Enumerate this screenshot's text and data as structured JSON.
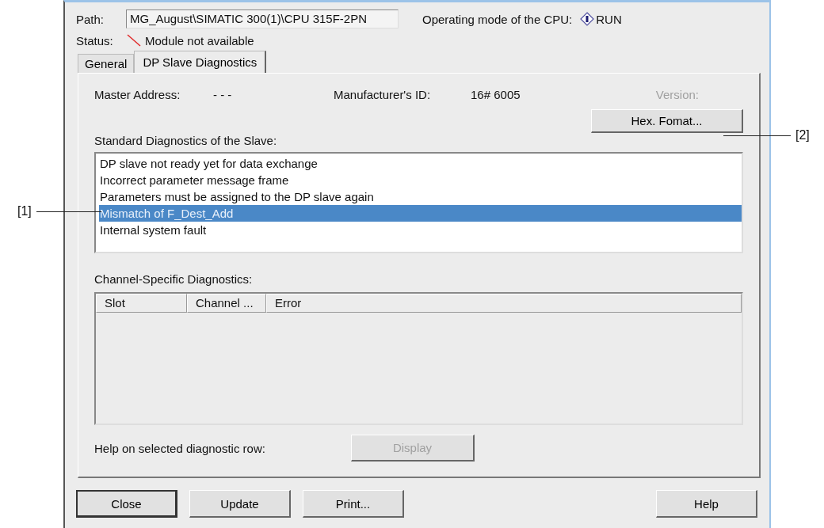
{
  "path": {
    "label": "Path:",
    "value": "MG_August\\SIMATIC 300(1)\\CPU 315F-2PN"
  },
  "operating_mode": {
    "label": "Operating mode of the  CPU:",
    "value": "RUN"
  },
  "status": {
    "label": "Status:",
    "value": "Module not available"
  },
  "tabs": [
    {
      "label": "General",
      "selected": false
    },
    {
      "label": "DP Slave Diagnostics",
      "selected": true
    }
  ],
  "master_address": {
    "label": "Master Address:",
    "value": "- - -"
  },
  "manufacturer_id": {
    "label": "Manufacturer's ID:",
    "value": "16# 6005"
  },
  "version": {
    "label": "Version:",
    "disabled": true
  },
  "hex_button": "Hex. Fomat...",
  "standard_diagnostics": {
    "label": "Standard Diagnostics of the Slave:",
    "items": [
      {
        "text": "DP slave not ready yet for data exchange",
        "selected": false
      },
      {
        "text": "Incorrect parameter message frame",
        "selected": false
      },
      {
        "text": "Parameters must be assigned to the DP slave again",
        "selected": false
      },
      {
        "text": "Mismatch of F_Dest_Add",
        "selected": true
      },
      {
        "text": "Internal system fault",
        "selected": false
      }
    ]
  },
  "channel_diagnostics": {
    "label": "Channel-Specific Diagnostics:",
    "columns": [
      "Slot",
      "Channel ...",
      "Error"
    ]
  },
  "help_row": {
    "label": "Help on selected diagnostic row:",
    "button": "Display",
    "disabled": true
  },
  "buttons": [
    {
      "label": "Close",
      "default": true
    },
    {
      "label": "Update",
      "default": false
    },
    {
      "label": "Print...",
      "default": false
    },
    {
      "label": "Help",
      "default": false
    }
  ],
  "callouts": [
    "[1]",
    "[2]"
  ]
}
